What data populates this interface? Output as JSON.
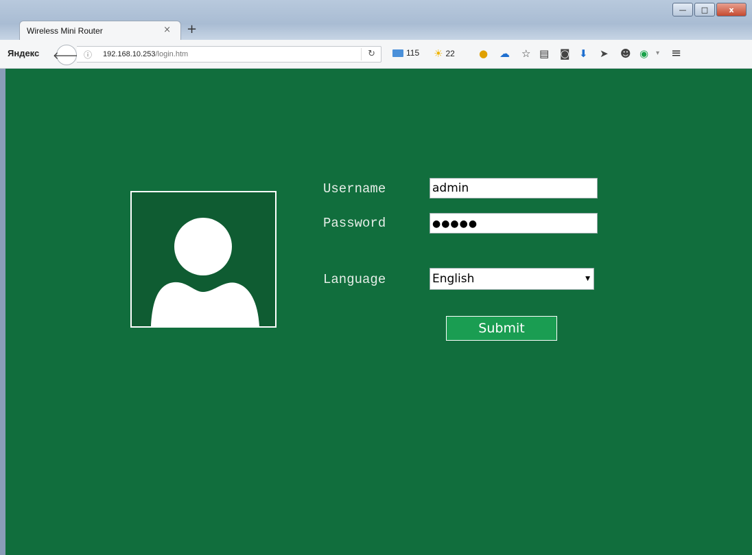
{
  "browser": {
    "tab_title": "Wireless Mini Router",
    "tab_close": "×",
    "new_tab": "+",
    "brand": "Яндекс",
    "url_host": "192.168.10.253",
    "url_path": "/login.htm",
    "mail_count": "115",
    "weather": "22",
    "window_controls": {
      "minimize": "—",
      "maximize": "□",
      "close": "x"
    }
  },
  "login": {
    "username_label": "Username",
    "username_value": "admin",
    "password_label": "Password",
    "password_value": "●●●●●",
    "language_label": "Language",
    "language_value": "English",
    "submit_label": "Submit"
  },
  "colors": {
    "page_bg": "#116e3d",
    "avatar_bg": "#0f5c32",
    "submit_bg": "#1a9d52"
  }
}
